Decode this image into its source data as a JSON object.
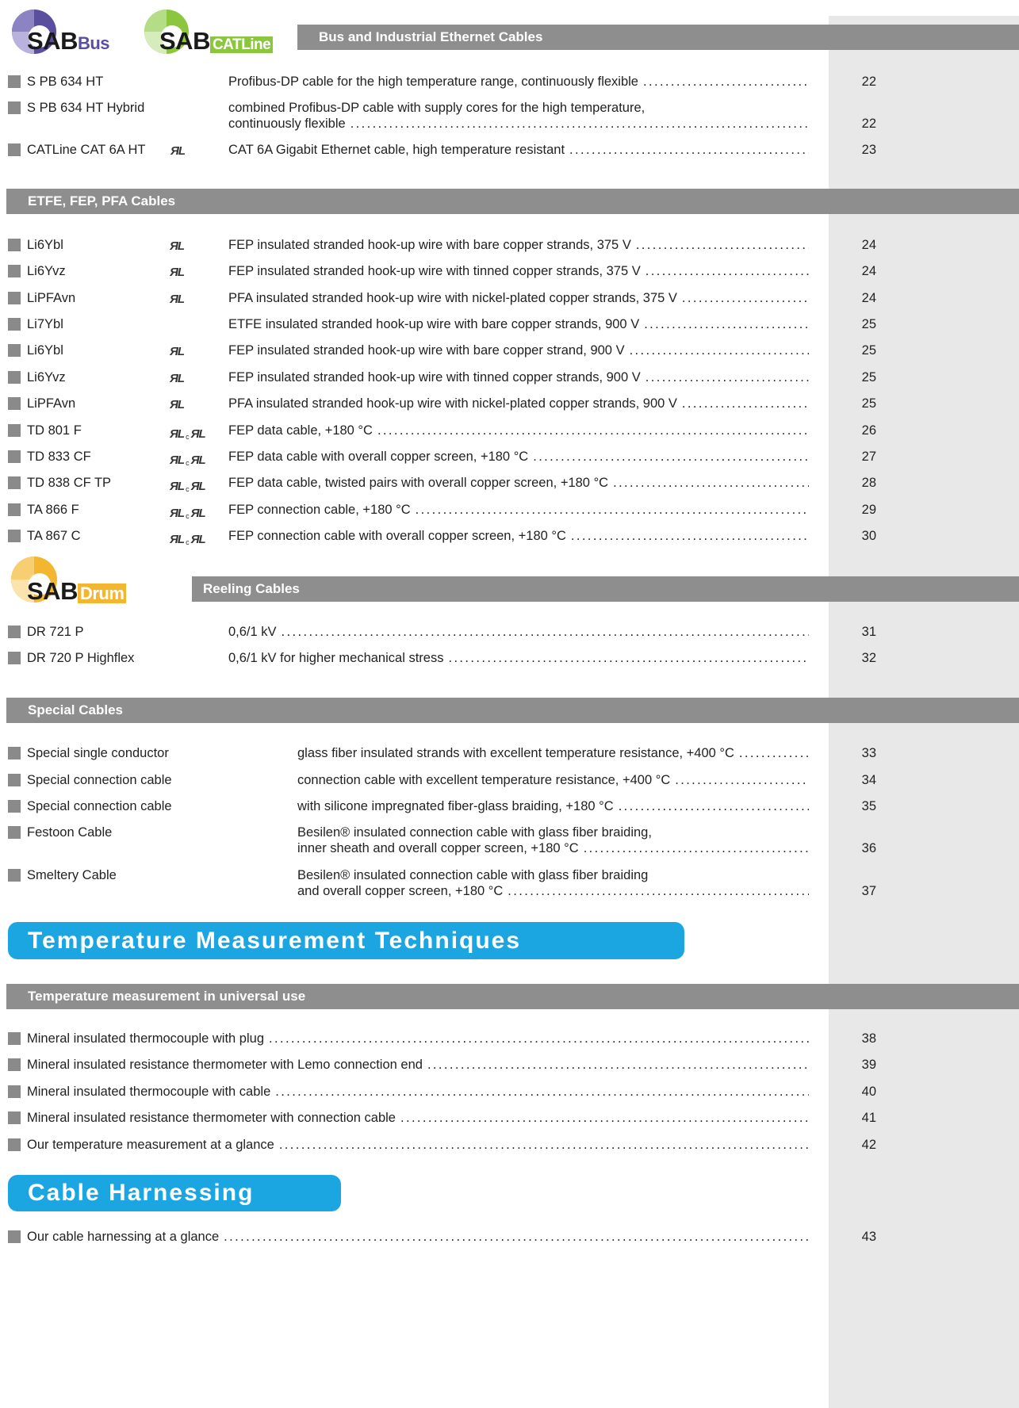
{
  "logos": {
    "sabbus": {
      "main": "SAB",
      "sub": "Bus"
    },
    "sabcatline": {
      "main": "SAB",
      "sub": "CATLine"
    },
    "sabdrum": {
      "main": "SAB",
      "sub": "Drum"
    }
  },
  "sections": {
    "bus": "Bus and Industrial Ethernet Cables",
    "etfe": "ETFE, FEP, PFA Cables",
    "reeling": "Reeling Cables",
    "special": "Special Cables",
    "temp_universal": "Temperature measurement in universal use"
  },
  "big_titles": {
    "temperature": "Temperature Measurement Techniques",
    "harnessing": "Cable Harnessing"
  },
  "ul_mark": "ЯL",
  "ul_c": "c",
  "bus_items": [
    {
      "name": "S PB 634 HT",
      "desc": "Profibus-DP cable for the high temperature range, continuously flexible",
      "page": "22"
    },
    {
      "name": "S PB 634 HT Hybrid",
      "desc1": "combined Profibus-DP cable with supply cores for the high temperature,",
      "desc2": "continuously flexible",
      "page": "22"
    },
    {
      "name": "CATLine CAT 6A HT",
      "desc": "CAT 6A Gigabit Ethernet cable, high temperature resistant",
      "page": "23"
    }
  ],
  "etfe_items": [
    {
      "name": "Li6Ybl",
      "desc": "FEP insulated stranded hook-up wire with bare copper strands, 375 V",
      "page": "24"
    },
    {
      "name": "Li6Yvz",
      "desc": "FEP insulated stranded hook-up wire with tinned copper strands, 375 V",
      "page": "24"
    },
    {
      "name": "LiPFAvn",
      "desc": "PFA insulated stranded hook-up wire with nickel-plated copper strands, 375 V",
      "page": "24"
    },
    {
      "name": "Li7Ybl",
      "desc": "ETFE insulated stranded hook-up wire with bare copper strands, 900 V",
      "page": "25"
    },
    {
      "name": "Li6Ybl",
      "desc": "FEP insulated stranded hook-up wire with bare copper strand, 900 V",
      "page": "25"
    },
    {
      "name": "Li6Yvz",
      "desc": "FEP insulated stranded hook-up wire with tinned copper strands, 900 V",
      "page": "25"
    },
    {
      "name": "LiPFAvn",
      "desc": "PFA insulated stranded hook-up wire with nickel-plated copper strands, 900 V",
      "page": "25"
    },
    {
      "name": "TD 801 F",
      "desc": "FEP data cable, +180 °C",
      "page": "26"
    },
    {
      "name": "TD 833 CF",
      "desc": "FEP data cable with overall copper screen, +180 °C",
      "page": "27"
    },
    {
      "name": "TD 838 CF TP",
      "desc": "FEP data cable, twisted pairs with overall copper screen, +180 °C",
      "page": "28"
    },
    {
      "name": "TA 866 F",
      "desc": "FEP connection cable, +180 °C",
      "page": "29"
    },
    {
      "name": "TA 867 C",
      "desc": "FEP connection cable with overall copper screen, +180 °C",
      "page": "30"
    }
  ],
  "reeling_items": [
    {
      "name": "DR 721 P",
      "desc": "0,6/1 kV",
      "page": "31"
    },
    {
      "name": "DR 720 P Highflex",
      "desc": "0,6/1 kV for higher mechanical stress",
      "page": "32"
    }
  ],
  "special_items": [
    {
      "name": "Special single conductor",
      "desc": "glass fiber insulated strands with excellent temperature resistance, +400 °C",
      "page": "33"
    },
    {
      "name": "Special connection cable",
      "desc": "connection cable with excellent temperature resistance, +400 °C",
      "page": "34"
    },
    {
      "name": "Special connection cable",
      "desc": "with silicone impregnated fiber-glass braiding, +180 °C",
      "page": "35"
    },
    {
      "name": "Festoon Cable",
      "desc1": "Besilen® insulated connection cable with glass fiber braiding,",
      "desc2": "inner sheath and overall copper screen, +180 °C",
      "page": "36"
    },
    {
      "name": "Smeltery Cable",
      "desc1": "Besilen® insulated connection cable with glass fiber braiding",
      "desc2": "and overall copper screen, +180 °C",
      "page": "37"
    }
  ],
  "temp_items": [
    {
      "name": "Mineral insulated thermocouple with plug",
      "page": "38"
    },
    {
      "name": "Mineral insulated resistance thermometer with Lemo connection end",
      "page": "39"
    },
    {
      "name": "Mineral insulated thermocouple with cable",
      "page": "40"
    },
    {
      "name": "Mineral insulated resistance thermometer with connection cable",
      "page": "41"
    },
    {
      "name": "Our temperature measurement at a glance",
      "page": "42"
    }
  ],
  "harness_items": [
    {
      "name": "Our cable harnessing at a glance",
      "page": "43"
    }
  ],
  "colors": {
    "bar": "#8e8e8e",
    "accent_blue": "#1ba6e1",
    "sabbus_purple": "#5a4f9e",
    "catline_green": "#8cc63f",
    "drum_yellow": "#f2b631",
    "page_column": "#e8e8e8"
  }
}
